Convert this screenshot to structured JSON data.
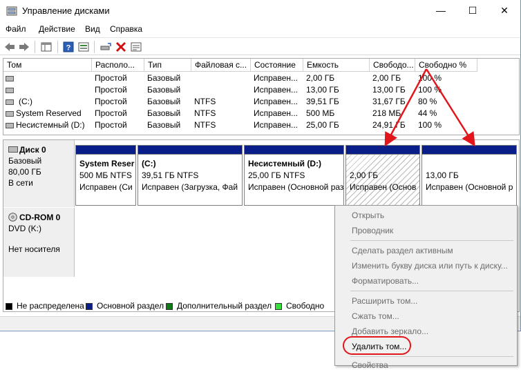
{
  "window": {
    "title": "Управление дисками",
    "controls": {
      "minimize": "—",
      "maximize": "☐",
      "close": "✕"
    }
  },
  "menu": [
    "Файл",
    "Действие",
    "Вид",
    "Справка"
  ],
  "volume_table": {
    "columns": [
      "Том",
      "Располо...",
      "Тип",
      "Файловая с...",
      "Состояние",
      "Емкость",
      "Свободо...",
      "Свободно %"
    ],
    "rows": [
      {
        "name": "",
        "layout": "Простой",
        "type": "Базовый",
        "fs": "",
        "status": "Исправен...",
        "capacity": "2,00 ГБ",
        "free": "2,00 ГБ",
        "free_pct": "100 %"
      },
      {
        "name": "",
        "layout": "Простой",
        "type": "Базовый",
        "fs": "",
        "status": "Исправен...",
        "capacity": "13,00 ГБ",
        "free": "13,00 ГБ",
        "free_pct": "100 %"
      },
      {
        "name": "(C:)",
        "layout": "Простой",
        "type": "Базовый",
        "fs": "NTFS",
        "status": "Исправен...",
        "capacity": "39,51 ГБ",
        "free": "31,67 ГБ",
        "free_pct": "80 %"
      },
      {
        "name": "System Reserved",
        "layout": "Простой",
        "type": "Базовый",
        "fs": "NTFS",
        "status": "Исправен...",
        "capacity": "500 МБ",
        "free": "218 МБ",
        "free_pct": "44 %"
      },
      {
        "name": "Несистемный (D:)",
        "layout": "Простой",
        "type": "Базовый",
        "fs": "NTFS",
        "status": "Исправен...",
        "capacity": "25,00 ГБ",
        "free": "24,91 ГБ",
        "free_pct": "100 %"
      }
    ]
  },
  "disks": {
    "disk0": {
      "name": "Диск 0",
      "type": "Базовый",
      "size": "80,00 ГБ",
      "state": "В сети"
    },
    "cdrom0": {
      "name": "CD-ROM 0",
      "type": "DVD (K:)",
      "state": "Нет носителя"
    }
  },
  "partitions": [
    {
      "title": "System Reser",
      "line2": "500 МБ NTFS",
      "line3": "Исправен (Си"
    },
    {
      "title": "(C:)",
      "line2": "39,51 ГБ NTFS",
      "line3": "Исправен (Загрузка, Фай"
    },
    {
      "title": "Несистемный  (D:)",
      "line2": "25,00 ГБ NTFS",
      "line3": "Исправен (Основной раз"
    },
    {
      "title": "",
      "line2": "2,00 ГБ",
      "line3": "Исправен (Основ"
    },
    {
      "title": "",
      "line2": "13,00 ГБ",
      "line3": "Исправен (Основной р"
    }
  ],
  "legend": [
    {
      "label": "Не распределена",
      "color": "#000000"
    },
    {
      "label": "Основной раздел",
      "color": "#0a1e8a"
    },
    {
      "label": "Дополнительный раздел",
      "color": "#0e7a16"
    },
    {
      "label": "Свободно",
      "color": "#35e03a"
    }
  ],
  "context_menu": {
    "open": "Открыть",
    "explorer": "Проводник",
    "mark_active": "Сделать раздел активным",
    "change_letter": "Изменить букву диска или путь к диску...",
    "format": "Форматировать...",
    "extend": "Расширить том...",
    "shrink": "Сжать том...",
    "add_mirror": "Добавить зеркало...",
    "delete": "Удалить том...",
    "properties": "Свойства"
  },
  "colors": {
    "primary_partition": "#0a1e8a",
    "highlight": "#e2151b"
  }
}
